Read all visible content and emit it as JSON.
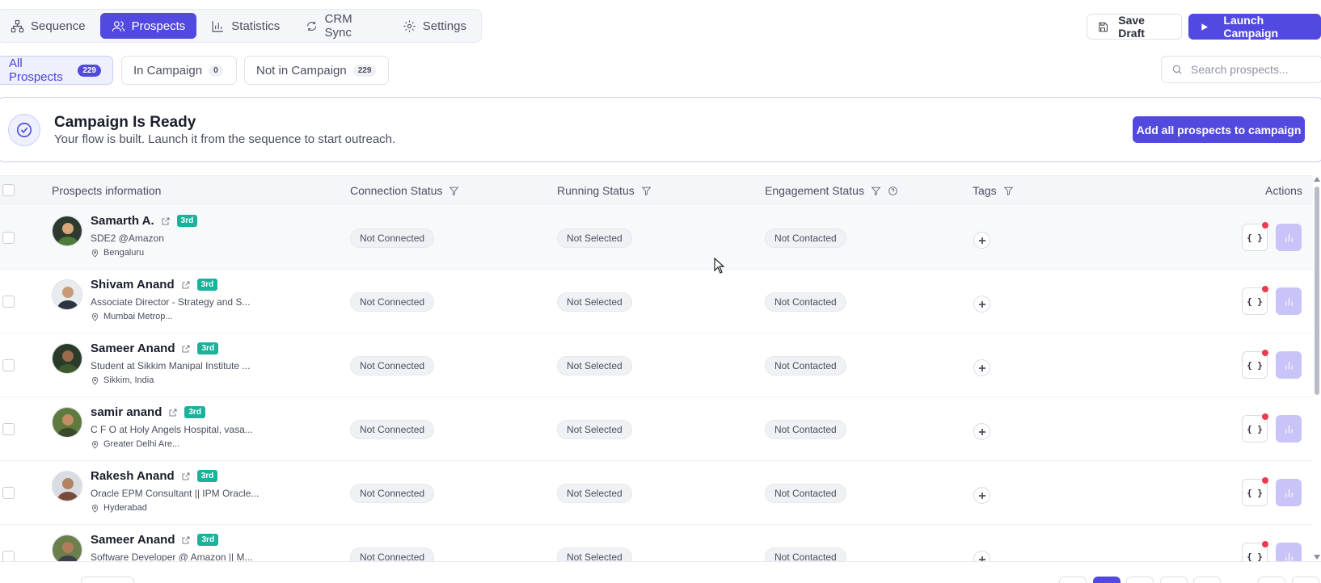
{
  "header": {
    "tabs": [
      {
        "label": "Sequence",
        "icon": "sequence-icon",
        "active": false
      },
      {
        "label": "Prospects",
        "icon": "users-icon",
        "active": true
      },
      {
        "label": "Statistics",
        "icon": "bar-chart-icon",
        "active": false
      },
      {
        "label": "CRM Sync",
        "icon": "sync-icon",
        "active": false
      },
      {
        "label": "Settings",
        "icon": "gear-icon",
        "active": false
      }
    ],
    "save_draft_label": "Save Draft",
    "launch_label": "Launch Campaign"
  },
  "filters": {
    "items": [
      {
        "label": "All Prospects",
        "count": "229",
        "active": true
      },
      {
        "label": "In Campaign",
        "count": "0",
        "active": false
      },
      {
        "label": "Not in Campaign",
        "count": "229",
        "active": false
      }
    ],
    "search_placeholder": "Search prospects..."
  },
  "banner": {
    "title": "Campaign Is Ready",
    "subtitle": "Your flow is built. Launch it from the sequence to start outreach.",
    "button_label": "Add all prospects to campaign"
  },
  "table": {
    "columns": {
      "info": "Prospects information",
      "connection": "Connection Status",
      "running": "Running Status",
      "engagement": "Engagement Status",
      "tags": "Tags",
      "actions": "Actions"
    },
    "rows": [
      {
        "name": "Samarth A.",
        "degree": "3rd",
        "title": "SDE2 @Amazon",
        "location": "Bengaluru",
        "connection": "Not Connected",
        "running": "Not Selected",
        "engagement": "Not Contacted"
      },
      {
        "name": "Shivam Anand",
        "degree": "3rd",
        "title": "Associate Director - Strategy and S...",
        "location": "Mumbai Metrop...",
        "connection": "Not Connected",
        "running": "Not Selected",
        "engagement": "Not Contacted"
      },
      {
        "name": "Sameer Anand",
        "degree": "3rd",
        "title": "Student at Sikkim Manipal Institute ...",
        "location": "Sikkim, India",
        "connection": "Not Connected",
        "running": "Not Selected",
        "engagement": "Not Contacted"
      },
      {
        "name": "samir anand",
        "degree": "3rd",
        "title": "C F O at Holy Angels Hospital, vasa...",
        "location": "Greater Delhi Are...",
        "connection": "Not Connected",
        "running": "Not Selected",
        "engagement": "Not Contacted"
      },
      {
        "name": "Rakesh Anand",
        "degree": "3rd",
        "title": "Oracle EPM Consultant || IPM Oracle...",
        "location": "Hyderabad",
        "connection": "Not Connected",
        "running": "Not Selected",
        "engagement": "Not Contacted"
      },
      {
        "name": "Sameer Anand",
        "degree": "3rd",
        "title": "Software Developer @ Amazon || M...",
        "location": "",
        "connection": "Not Connected",
        "running": "Not Selected",
        "engagement": "Not Contacted"
      }
    ],
    "action_code_label": "{ }"
  },
  "colors": {
    "accent": "#5249e0",
    "degree_badge": "#18b39a",
    "notification_dot": "#f0384f"
  }
}
